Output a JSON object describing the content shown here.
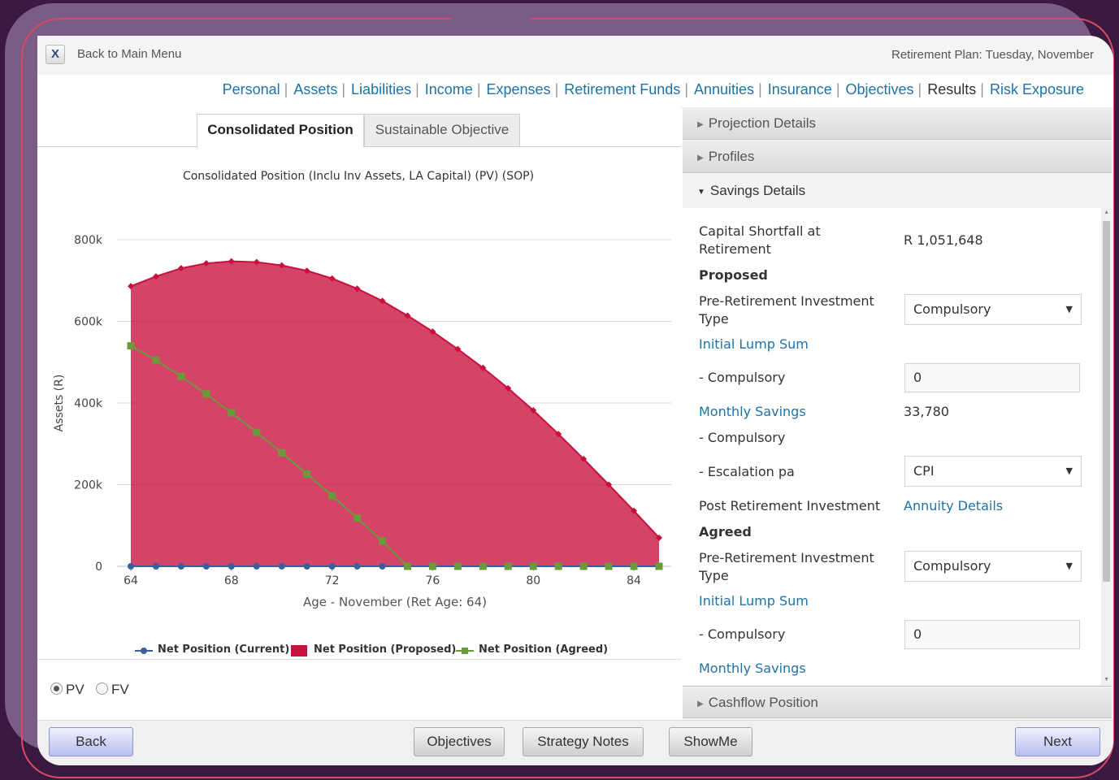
{
  "header": {
    "close_icon_label": "X",
    "back_label": "Back to Main Menu",
    "plan_title": "Retirement Plan: Tuesday, November"
  },
  "nav": {
    "items": [
      "Personal",
      "Assets",
      "Liabilities",
      "Income",
      "Expenses",
      "Retirement Funds",
      "Annuities",
      "Insurance",
      "Objectives",
      "Results",
      "Risk Exposure"
    ],
    "active": "Results"
  },
  "tabs": {
    "active": "Consolidated Position",
    "inactive": "Sustainable Objective"
  },
  "chart_data": {
    "type": "area",
    "title": "Consolidated Position (Inclu Inv Assets, LA Capital) (PV) (SOP)",
    "xlabel": "Age - November (Ret Age: 64)",
    "ylabel": "Assets (R)",
    "x_ticks": [
      64,
      68,
      72,
      76,
      80,
      84
    ],
    "y_ticks": [
      "0",
      "200k",
      "400k",
      "600k",
      "800k"
    ],
    "ylim": [
      0,
      800000
    ],
    "xlim": [
      64,
      85
    ],
    "grid": true,
    "legend_position": "bottom",
    "x": [
      64,
      65,
      66,
      67,
      68,
      69,
      70,
      71,
      72,
      73,
      74,
      75,
      76,
      77,
      78,
      79,
      80,
      81,
      82,
      83,
      84,
      85
    ],
    "series": [
      {
        "name": "Net Position (Current)",
        "kind": "line",
        "color": "#3a5f9a",
        "values": [
          0,
          0,
          0,
          0,
          0,
          0,
          0,
          0,
          0,
          0,
          0,
          0,
          0,
          0,
          0,
          0,
          0,
          0,
          0,
          0,
          0,
          0
        ]
      },
      {
        "name": "Net Position (Proposed)",
        "kind": "area",
        "color": "#c8103e",
        "values": [
          686000,
          710000,
          730000,
          742000,
          747000,
          745000,
          737000,
          724000,
          705000,
          680000,
          650000,
          614000,
          575000,
          532000,
          486000,
          436000,
          382000,
          324000,
          263000,
          200000,
          136000,
          70000
        ]
      },
      {
        "name": "Net Position (Agreed)",
        "kind": "line",
        "color": "#6b9a3c",
        "values": [
          540000,
          505000,
          465000,
          422000,
          376000,
          328000,
          278000,
          226000,
          173000,
          118000,
          62000,
          0,
          0,
          0,
          0,
          0,
          0,
          0,
          0,
          0,
          0,
          0
        ]
      }
    ]
  },
  "radio": {
    "pv_label": "PV",
    "fv_label": "FV",
    "selected": "PV"
  },
  "accordion": {
    "projection_details": "Projection Details",
    "profiles": "Profiles",
    "savings_details": "Savings Details",
    "cashflow_position": "Cashflow Position"
  },
  "savings": {
    "shortfall_label_1": "Capital Shortfall at",
    "shortfall_label_2": "Retirement",
    "shortfall_value": "R 1,051,648",
    "proposed_heading": "Proposed",
    "pre_ret_label_1": "Pre-Retirement Investment",
    "pre_ret_label_2": "Type",
    "pre_ret_value": "Compulsory",
    "initial_lump_sum": "Initial Lump Sum",
    "compulsory_label": "- Compulsory",
    "lump_sum_value": "0",
    "monthly_savings": "Monthly Savings",
    "monthly_savings_value": "33,780",
    "escalation_label": "- Escalation pa",
    "escalation_value": "CPI",
    "post_ret_label": "Post Retirement Investment",
    "annuity_details": "Annuity Details",
    "agreed_heading": "Agreed",
    "agreed_pre_ret_value": "Compulsory",
    "agreed_lump_sum_value": "0"
  },
  "buttons": {
    "back": "Back",
    "objectives": "Objectives",
    "strategy_notes": "Strategy Notes",
    "showme": "ShowMe",
    "next": "Next"
  }
}
